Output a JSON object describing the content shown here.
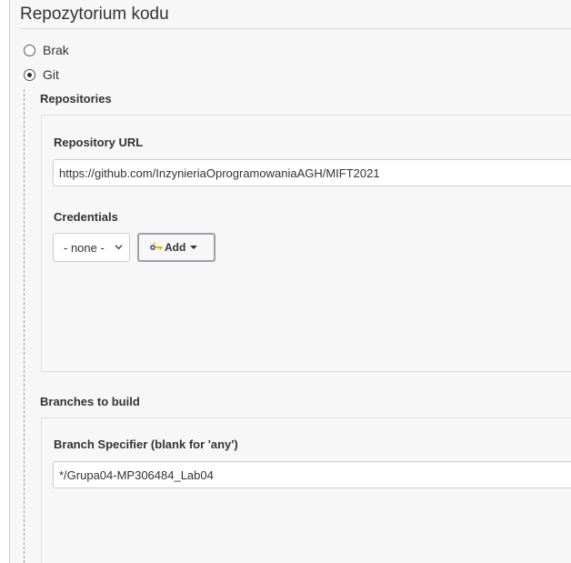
{
  "section": {
    "title": "Repozytorium kodu"
  },
  "scm_options": [
    {
      "label": "Brak",
      "checked": false
    },
    {
      "label": "Git",
      "checked": true
    }
  ],
  "repositories": {
    "label": "Repositories",
    "url_label": "Repository URL",
    "url_value": "https://github.com/InzynieriaOprogramowaniaAGH/MIFT2021",
    "credentials_label": "Credentials",
    "credentials_selected": "- none -",
    "add_button_label": "Add",
    "add_button_icon": "key-icon"
  },
  "branches": {
    "label": "Branches to build",
    "specifier_label": "Branch Specifier (blank for 'any')",
    "specifier_value": "*/Grupa04-MP306484_Lab04"
  },
  "colors": {
    "background": "#f7f7f7",
    "border": "#dddddd",
    "text": "#333333",
    "key_icon": "#e8b400"
  }
}
